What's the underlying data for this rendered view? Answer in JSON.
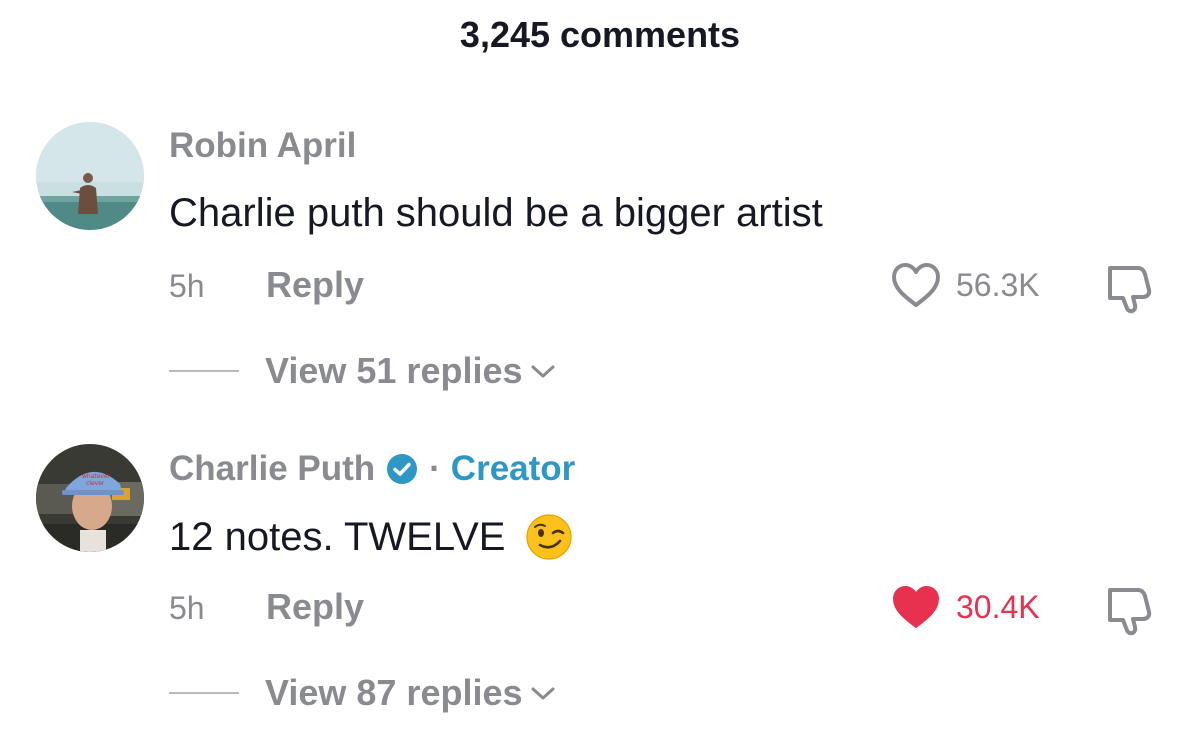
{
  "header": {
    "title": "3,245 comments"
  },
  "comments": [
    {
      "author": "Robin April",
      "text": "Charlie puth should be a bigger artist",
      "time": "5h",
      "reply_label": "Reply",
      "likes": "56.3K",
      "liked": false,
      "replies_label": "View 51 replies"
    },
    {
      "author": "Charlie Puth",
      "verified": true,
      "separator": "·",
      "badge": "Creator",
      "text": "12 notes. TWELVE",
      "emoji": "winking-face",
      "time": "5h",
      "reply_label": "Reply",
      "likes": "30.4K",
      "liked": true,
      "replies_label": "View 87 replies"
    }
  ],
  "colors": {
    "liked": "#e8314f",
    "creator": "#2e97c6",
    "muted": "#8a8b91"
  }
}
